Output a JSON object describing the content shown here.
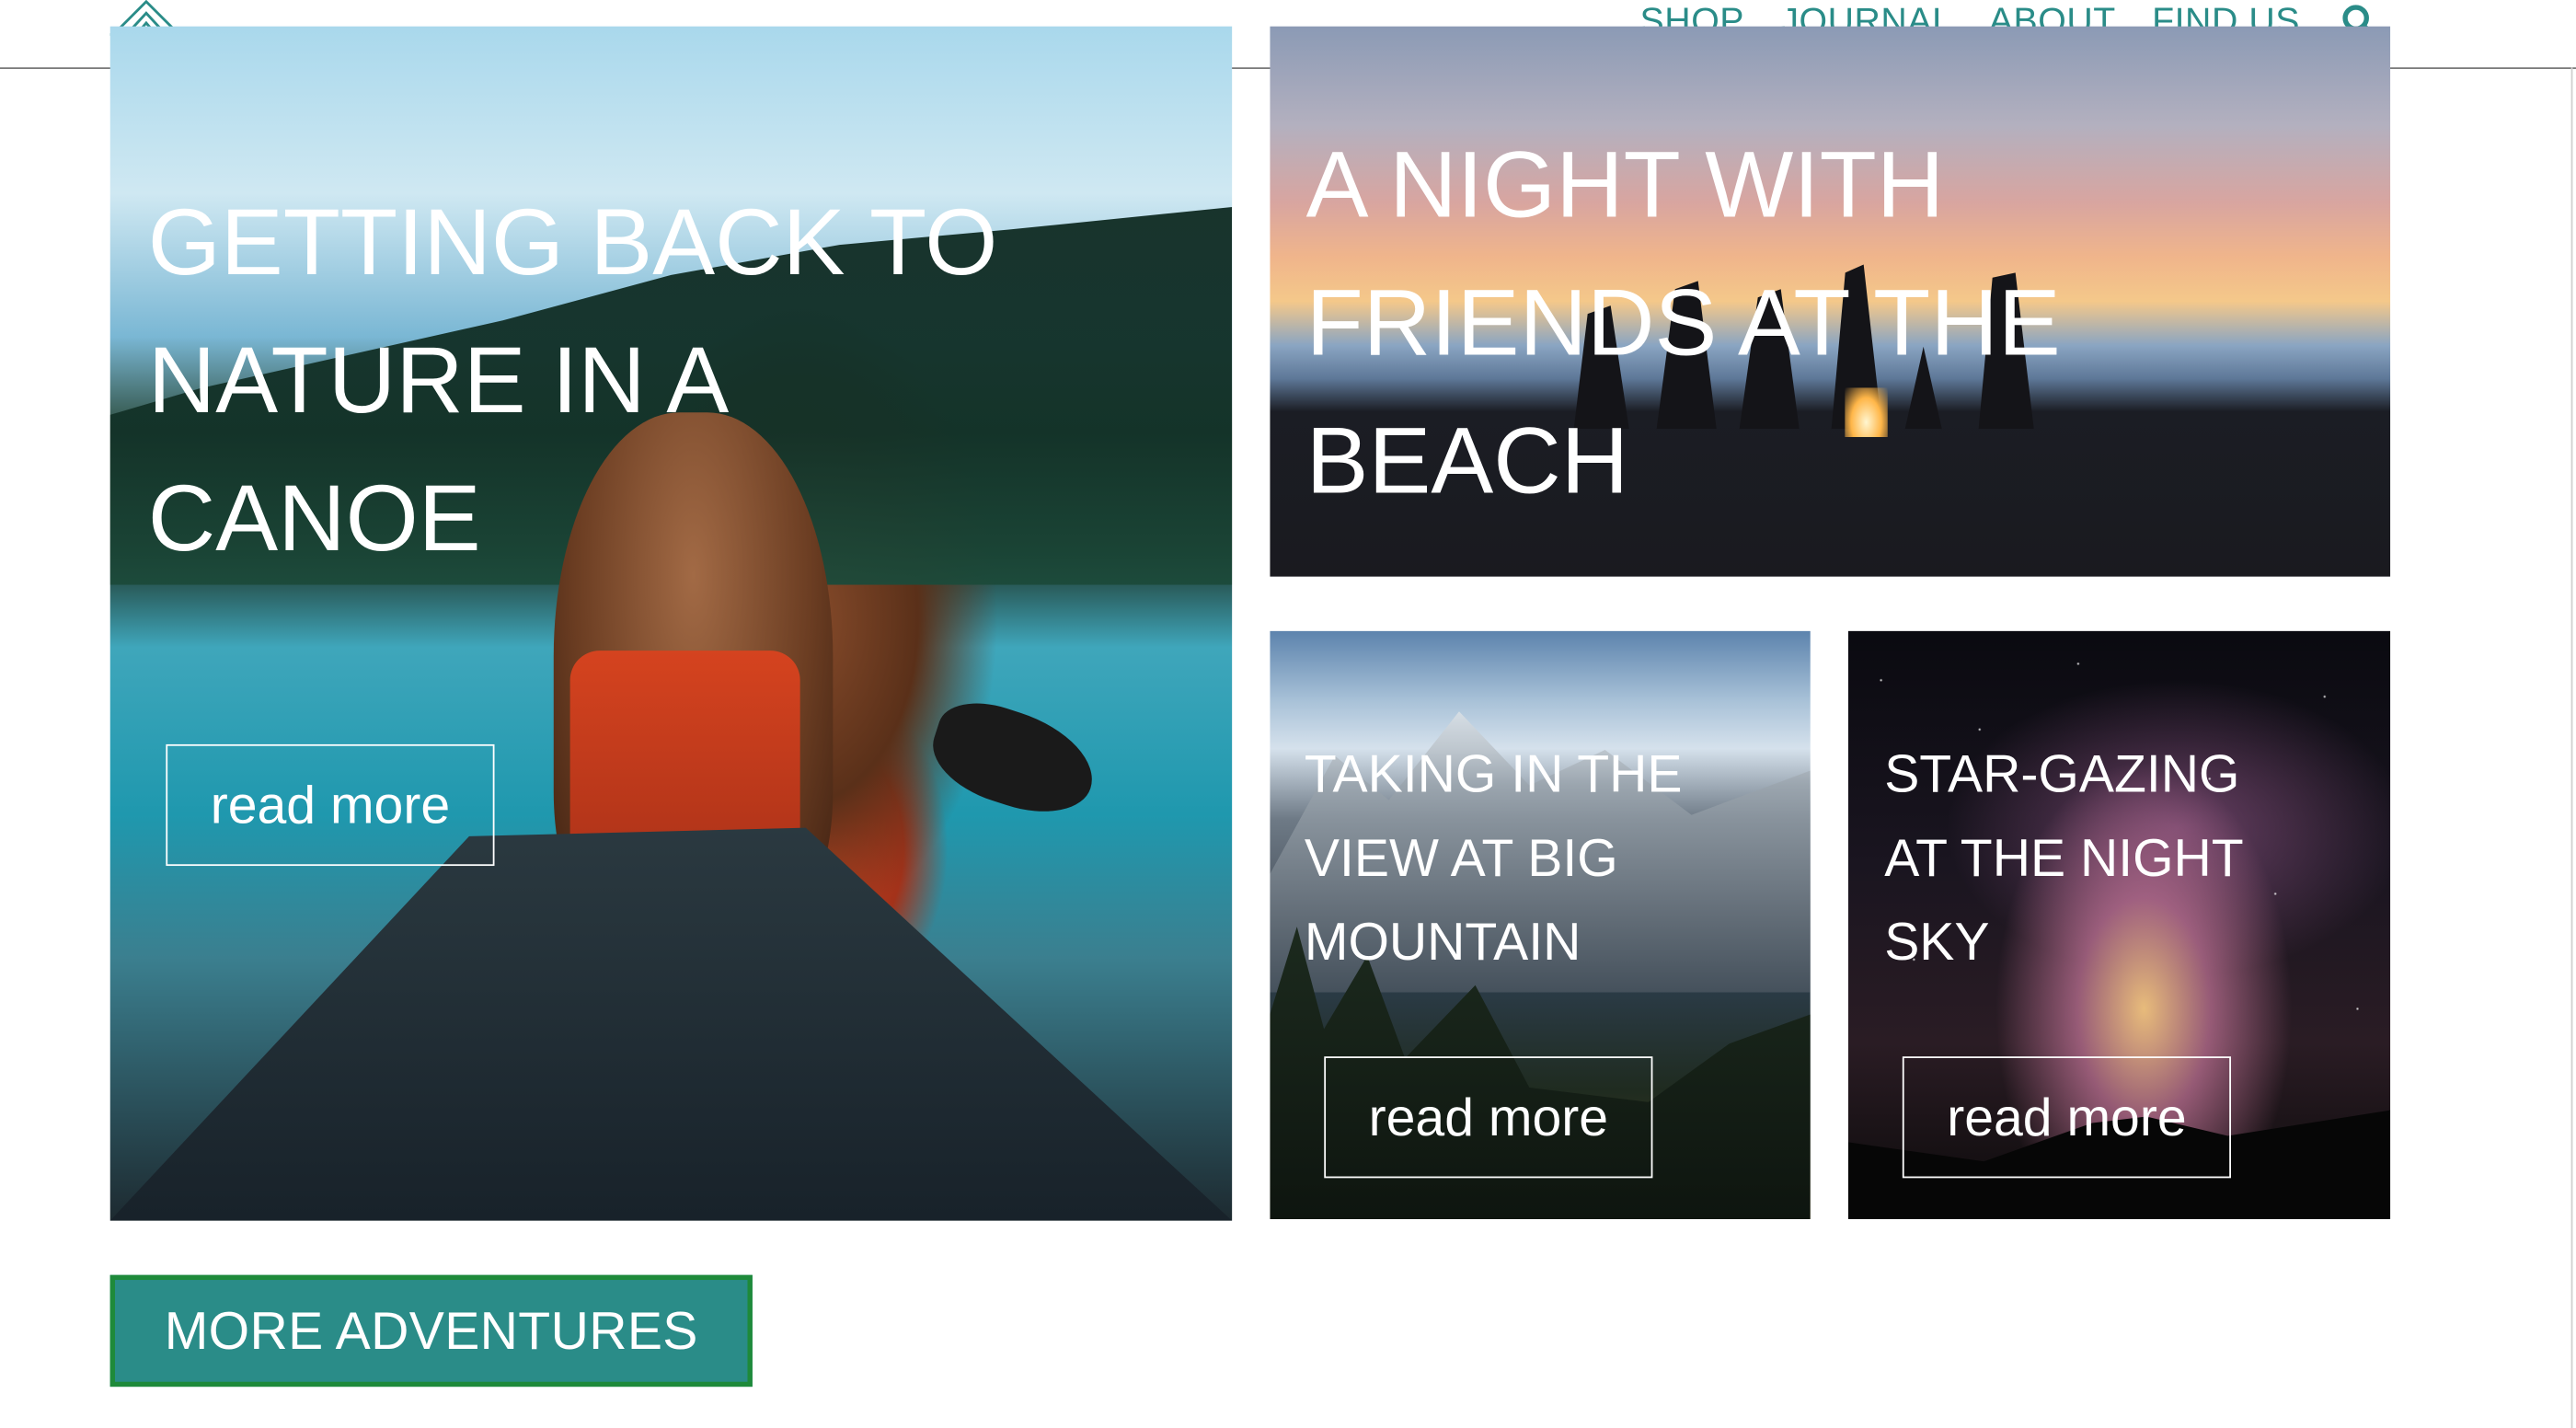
{
  "header": {
    "logo_icon": "tent-logo-icon",
    "nav": [
      {
        "label": "SHOP"
      },
      {
        "label": "JOURNAL"
      },
      {
        "label": "ABOUT"
      },
      {
        "label": "FIND US"
      }
    ],
    "search_icon": "search-icon",
    "accent_color": "#2a8c88"
  },
  "cards": [
    {
      "title": "GETTING BACK TO\nNATURE IN A\nCANOE",
      "read_more": "read more"
    },
    {
      "title": "A NIGHT WITH\nFRIENDS AT THE\nBEACH"
    },
    {
      "title": "TAKING IN THE\nVIEW AT BIG\nMOUNTAIN",
      "read_more": "read more"
    },
    {
      "title": "STAR-GAZING\nAT THE NIGHT\nSKY",
      "read_more": "read more"
    }
  ],
  "more_button": {
    "label": "MORE ADVENTURES",
    "bg_color": "#2a8c88",
    "border_color": "#1e8a3a"
  }
}
